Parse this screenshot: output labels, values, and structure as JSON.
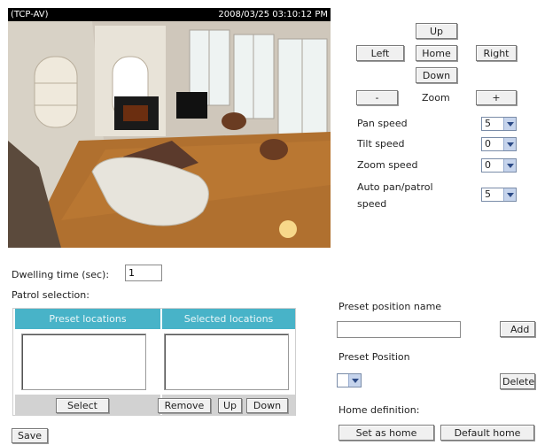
{
  "camera": {
    "name": "(TCP-AV)",
    "timestamp": "2008/03/25 03:10:12 PM"
  },
  "ptz": {
    "up": "Up",
    "left": "Left",
    "home": "Home",
    "right": "Right",
    "down": "Down",
    "zoom_out": "-",
    "zoom_label": "Zoom",
    "zoom_in": "+"
  },
  "speeds": [
    {
      "label": "Pan speed",
      "value": "5"
    },
    {
      "label": "Tilt speed",
      "value": "0"
    },
    {
      "label": "Zoom speed",
      "value": "0"
    },
    {
      "label_line1": "Auto pan/patrol",
      "label_line2": "speed",
      "value": "5"
    }
  ],
  "dwelling": {
    "label": "Dwelling time (sec):",
    "value": "1"
  },
  "patrol": {
    "title": "Patrol selection:",
    "col_preset": "Preset locations",
    "col_selected": "Selected locations",
    "select_button": "Select",
    "remove_button": "Remove",
    "up_button": "Up",
    "down_button": "Down"
  },
  "preset": {
    "name_label": "Preset position name",
    "name_value": "",
    "add_button": "Add",
    "position_label": "Preset Position",
    "position_value": "",
    "delete_button": "Delete"
  },
  "home_definition": {
    "label": "Home definition:",
    "set_as_home": "Set as home",
    "default_home": "Default home"
  },
  "save_button": "Save",
  "colors": {
    "table_header": "#48b3c8",
    "select_arrow": "#c6d4ec"
  },
  "icons": [
    "chevron-down-icon"
  ]
}
